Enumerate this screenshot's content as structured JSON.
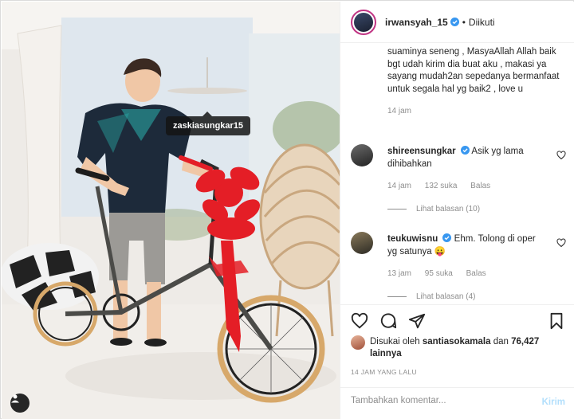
{
  "photo": {
    "tagged_user": "zaskiasungkar15"
  },
  "header": {
    "username": "irwansyah_15",
    "separator": "•",
    "follow_status": "Diikuti"
  },
  "caption": {
    "text": "suaminya seneng , MasyaAllah Allah baik bgt udah kirim dia buat aku , makasi ya sayang mudah2an sepedanya bermanfaat untuk segala hal yg baik2 , love u",
    "time": "14 jam"
  },
  "comments": [
    {
      "username": "shireensungkar",
      "verified": true,
      "text": "Asik yg lama dihibahkan",
      "time": "14 jam",
      "likes": "132 suka",
      "reply_label": "Balas",
      "view_replies": "Lihat balasan (10)"
    },
    {
      "username": "teukuwisnu",
      "verified": true,
      "text": "Ehm. Tolong di oper yg satunya 😛",
      "time": "13 jam",
      "likes": "95 suka",
      "reply_label": "Balas",
      "view_replies": "Lihat balasan (4)"
    }
  ],
  "actions": {
    "icons": [
      "heart-icon",
      "comment-icon",
      "share-icon",
      "bookmark-icon"
    ]
  },
  "likes": {
    "prefix": "Disukai oleh",
    "liker": "santiasokamala",
    "joiner": "dan",
    "count": "76,427 lainnya"
  },
  "timestamp": "14 JAM YANG LALU",
  "add_comment": {
    "placeholder": "Tambahkan komentar...",
    "post_label": "Kirim"
  },
  "colors": {
    "verified": "#3897f0",
    "muted": "#8e8e8e",
    "post_disabled": "#b2dffc",
    "ribbon": "#e41e26"
  }
}
